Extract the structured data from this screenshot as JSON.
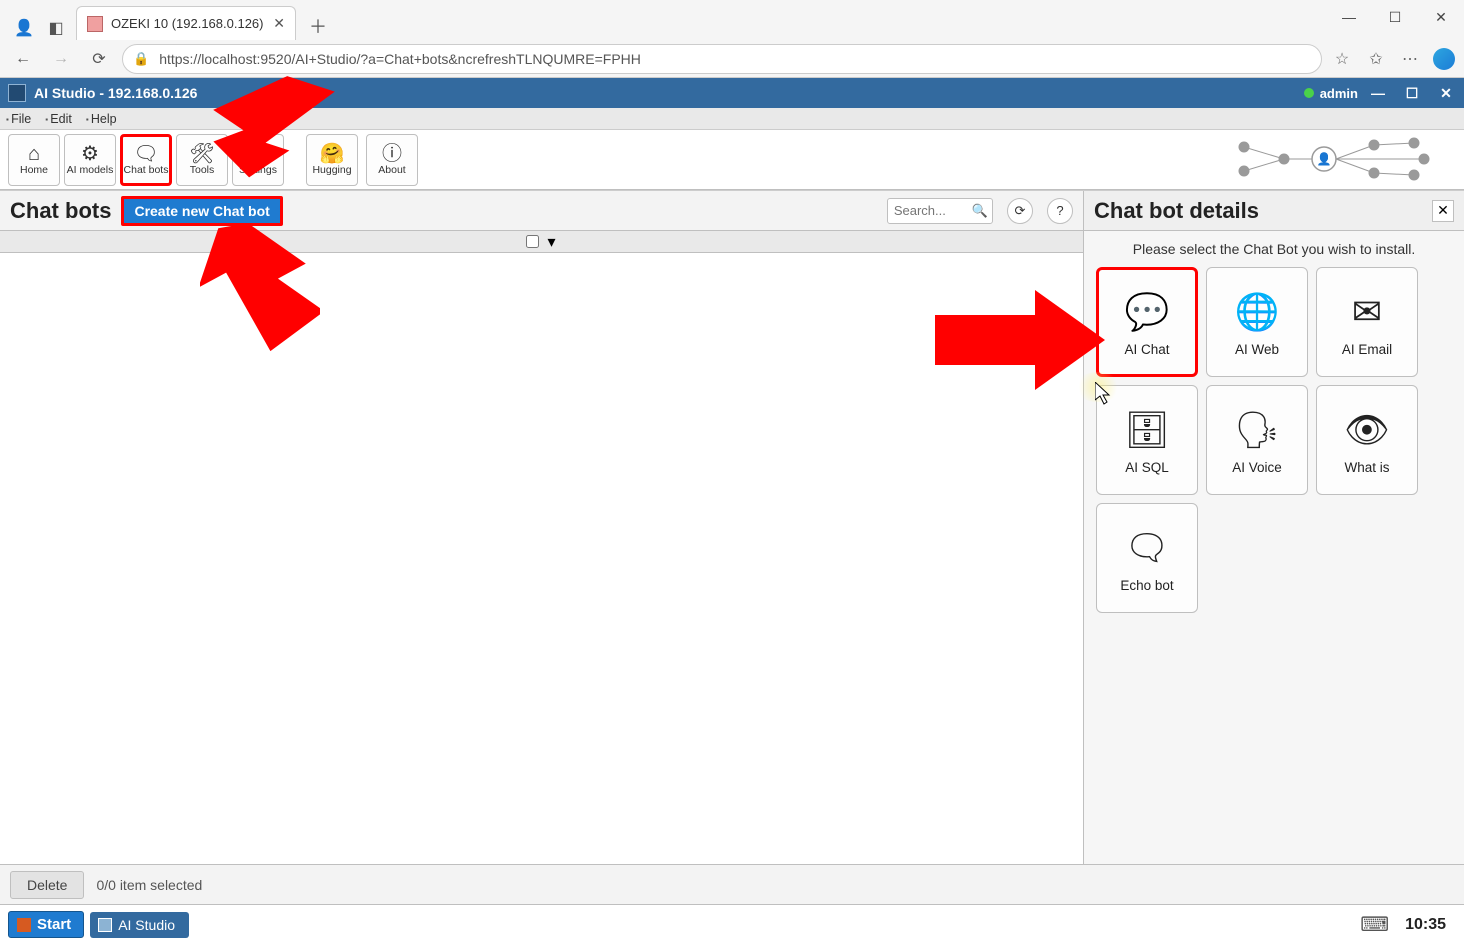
{
  "browser": {
    "tab_title": "OZEKI 10 (192.168.0.126)",
    "url": "https://localhost:9520/AI+Studio/?a=Chat+bots&ncrefreshTLNQUMRE=FPHH"
  },
  "titlebar": {
    "text": "AI Studio - 192.168.0.126",
    "user": "admin"
  },
  "menubar": {
    "file": "File",
    "edit": "Edit",
    "help": "Help"
  },
  "toolbar": {
    "home": "Home",
    "ai_models": "AI models",
    "chat_bots": "Chat bots",
    "tools": "Tools",
    "settings": "Settings",
    "hugging": "Hugging",
    "about": "About"
  },
  "left": {
    "heading": "Chat bots",
    "create_btn": "Create new Chat bot",
    "search_placeholder": "Search..."
  },
  "right": {
    "heading": "Chat bot details",
    "desc": "Please select the Chat Bot you wish to install.",
    "cards": [
      {
        "label": "AI Chat",
        "icon": "💬",
        "highlight": true
      },
      {
        "label": "AI Web",
        "icon": "🌐"
      },
      {
        "label": "AI Email",
        "icon": "✉"
      },
      {
        "label": "AI SQL",
        "icon": "🗄"
      },
      {
        "label": "AI Voice",
        "icon": "🗣"
      },
      {
        "label": "What is",
        "icon": "👁"
      },
      {
        "label": "Echo bot",
        "icon": "🗨"
      }
    ]
  },
  "footer": {
    "delete": "Delete",
    "status": "0/0 item selected"
  },
  "taskbar": {
    "start": "Start",
    "app": "AI Studio",
    "clock": "10:35"
  }
}
